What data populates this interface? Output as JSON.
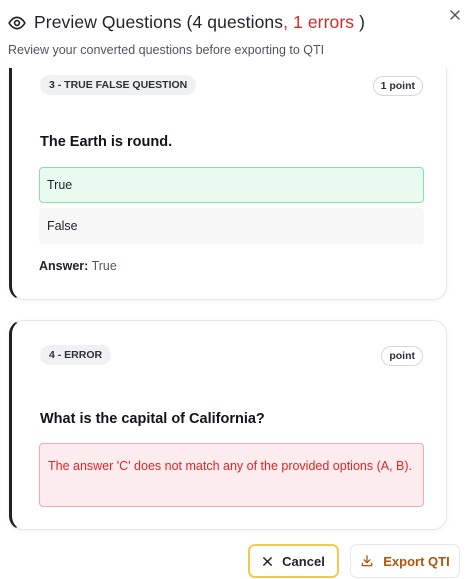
{
  "header": {
    "title_main": "Preview Questions (4 questions",
    "title_errors": ", 1 errors",
    "title_close": ")",
    "subtitle": "Review your converted questions before exporting to QTI"
  },
  "icons": {
    "header": "eye-icon",
    "close": "close-icon",
    "cancel": "x-icon",
    "export": "download-icon"
  },
  "questions": [
    {
      "type_label": "3 - TRUE FALSE QUESTION",
      "points_label": "1 point",
      "text": "The Earth is round.",
      "options": [
        {
          "label": "True",
          "correct": true
        },
        {
          "label": "False",
          "correct": false
        }
      ],
      "answer_label": "Answer:",
      "answer_value": "True"
    },
    {
      "type_label": "4 - ERROR",
      "points_label": "point",
      "text": "What is the capital of California?",
      "error": "The answer 'C' does not match any of the provided options (A, B)."
    }
  ],
  "footer": {
    "cancel_label": "Cancel",
    "export_label": "Export QTI"
  },
  "colors": {
    "error": "#dc2626",
    "correct_bg": "#e9fbf0",
    "correct_border": "#86e0a8",
    "cancel_border": "#f2c94c",
    "export_text": "#b45309"
  }
}
